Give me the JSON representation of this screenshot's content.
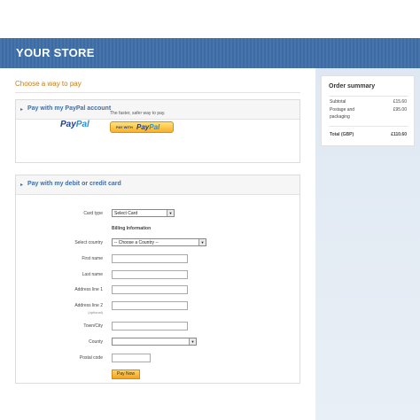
{
  "header": {
    "store_name": "YOUR STORE"
  },
  "main": {
    "choose_title": "Choose a way to pay",
    "paypal_section": {
      "title": "Pay with my PayPal account",
      "logo_pay": "Pay",
      "logo_pal": "Pal",
      "tagline": "The faster, safer way to pay.",
      "button_prefix": "PAY WITH",
      "button_pay": "Pay",
      "button_pal": "Pal"
    },
    "card_section": {
      "title": "Pay with my debit or credit card",
      "card_type_label": "Card type",
      "card_type_value": "Select Card",
      "billing_info": "Billing Information",
      "country_label": "Select country",
      "country_value": "-- Choose a Country --",
      "first_name_label": "First name",
      "last_name_label": "Last name",
      "address1_label": "Address line 1",
      "address2_label": "Address line 2",
      "address2_optional": "(optional)",
      "town_label": "Town/City",
      "county_label": "County",
      "postal_label": "Postal code",
      "pay_now": "Pay Now"
    }
  },
  "order_summary": {
    "title": "Order summary",
    "subtotal_label": "Subtotal",
    "subtotal_value": "£15.60",
    "postage_label_1": "Postage and",
    "postage_label_2": "packaging",
    "postage_value": "£95.00",
    "total_label": "Total (GBP)",
    "total_value": "£110.60"
  },
  "icons": {
    "chevron": "chevron-right-icon",
    "dropdown": "chevron-down-icon"
  },
  "colors": {
    "header_blue": "#3e6ea8",
    "accent_orange": "#c77c16",
    "paypal_navy": "#1e3f8a",
    "paypal_light": "#2b8fd6"
  }
}
